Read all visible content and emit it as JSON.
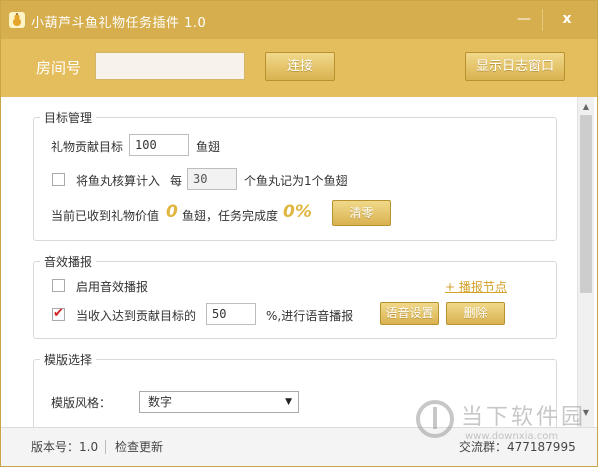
{
  "window": {
    "title": "小葫芦斗鱼礼物任务插件 1.0",
    "minimize_glyph": "—",
    "close_glyph": "x"
  },
  "connection": {
    "room_label": "房间号",
    "room_value": "",
    "connect_label": "连接",
    "show_log_label": "显示日志窗口"
  },
  "target_group": {
    "title": "目标管理",
    "gift_target_label": "礼物贡献目标",
    "gift_target_value": "100",
    "gift_target_unit": "鱼翅",
    "convert_checkbox_label": "将鱼丸核算计入",
    "convert_checked": false,
    "every_label": "每",
    "every_value": "30",
    "every_suffix": "个鱼丸记为1个鱼翅",
    "received_label": "当前已收到礼物价值",
    "received_value": "0",
    "received_unit": "鱼翅，任务完成度",
    "progress_value": "0%",
    "reset_label": "清零"
  },
  "sound_group": {
    "title": "音效播报",
    "enable_label": "启用音效播报",
    "enable_checked": false,
    "add_node_link": "+ 播报节点",
    "reach_label": "当收入达到贡献目标的",
    "reach_checked": true,
    "reach_value": "50",
    "reach_suffix": "%,进行语音播报",
    "voice_settings_label": "语音设置",
    "delete_label": "删除"
  },
  "template_group": {
    "title": "模版选择",
    "style_label": "模版风格：",
    "style_selected": "数字"
  },
  "statusbar": {
    "version": "版本号：1.0",
    "check_update": "检查更新",
    "group": "交流群：477187995"
  },
  "watermark": {
    "text": "当下软件园",
    "url": "www.downxia.com"
  },
  "colors": {
    "titlebar": "#d6ae4d",
    "connbar": "#e4bd5d",
    "accent_gold": "#e0b540",
    "check_red": "#d02020"
  }
}
